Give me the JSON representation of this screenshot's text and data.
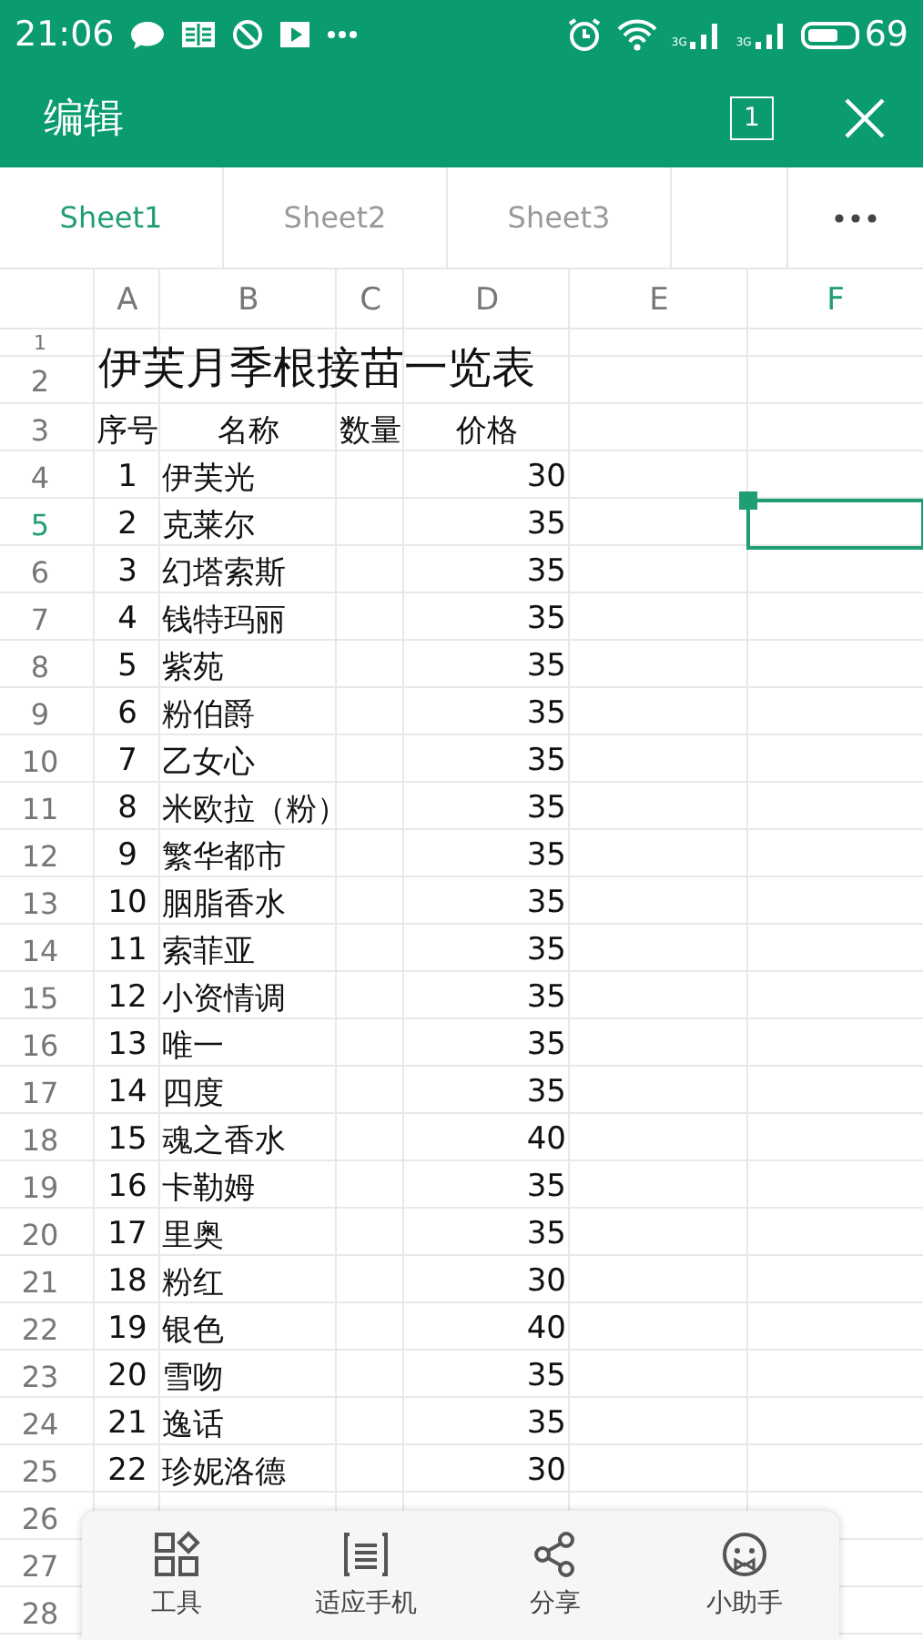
{
  "status_bar": {
    "time": "21:06",
    "network_labels": [
      "3G",
      "3G"
    ],
    "battery": "69"
  },
  "header": {
    "title": "编辑",
    "window_count": "1"
  },
  "tabs": [
    {
      "label": "Sheet1",
      "selected": true
    },
    {
      "label": "Sheet2",
      "selected": false
    },
    {
      "label": "Sheet3",
      "selected": false
    }
  ],
  "columns": [
    {
      "label": "A",
      "selected": false
    },
    {
      "label": "B",
      "selected": false
    },
    {
      "label": "C",
      "selected": false
    },
    {
      "label": "D",
      "selected": false
    },
    {
      "label": "E",
      "selected": false
    },
    {
      "label": "F",
      "selected": true
    }
  ],
  "row_headers": [
    {
      "label": "1",
      "selected": false
    },
    {
      "label": "2",
      "selected": false
    },
    {
      "label": "3",
      "selected": false
    },
    {
      "label": "4",
      "selected": false
    },
    {
      "label": "5",
      "selected": true
    },
    {
      "label": "6",
      "selected": false
    },
    {
      "label": "7",
      "selected": false
    },
    {
      "label": "8",
      "selected": false
    },
    {
      "label": "9",
      "selected": false
    },
    {
      "label": "10",
      "selected": false
    },
    {
      "label": "11",
      "selected": false
    },
    {
      "label": "12",
      "selected": false
    },
    {
      "label": "13",
      "selected": false
    },
    {
      "label": "14",
      "selected": false
    },
    {
      "label": "15",
      "selected": false
    },
    {
      "label": "16",
      "selected": false
    },
    {
      "label": "17",
      "selected": false
    },
    {
      "label": "18",
      "selected": false
    },
    {
      "label": "19",
      "selected": false
    },
    {
      "label": "20",
      "selected": false
    },
    {
      "label": "21",
      "selected": false
    },
    {
      "label": "22",
      "selected": false
    },
    {
      "label": "23",
      "selected": false
    },
    {
      "label": "24",
      "selected": false
    },
    {
      "label": "25",
      "selected": false
    },
    {
      "label": "26",
      "selected": false
    },
    {
      "label": "27",
      "selected": false
    },
    {
      "label": "28",
      "selected": false
    }
  ],
  "sheet_title": "伊芙月季根接苗一览表",
  "column_titles": [
    "序号",
    "名称",
    "数量",
    "价格"
  ],
  "records": [
    {
      "seq": "1",
      "name": "伊芙光",
      "price": "30"
    },
    {
      "seq": "2",
      "name": "克莱尔",
      "price": "35"
    },
    {
      "seq": "3",
      "name": "幻塔索斯",
      "price": "35"
    },
    {
      "seq": "4",
      "name": "钱特玛丽",
      "price": "35"
    },
    {
      "seq": "5",
      "name": "紫苑",
      "price": "35"
    },
    {
      "seq": "6",
      "name": "粉伯爵",
      "price": "35"
    },
    {
      "seq": "7",
      "name": "乙女心",
      "price": "35"
    },
    {
      "seq": "8",
      "name": "米欧拉（粉）",
      "price": "35"
    },
    {
      "seq": "9",
      "name": "繁华都市",
      "price": "35"
    },
    {
      "seq": "10",
      "name": "胭脂香水",
      "price": "35"
    },
    {
      "seq": "11",
      "name": "索菲亚",
      "price": "35"
    },
    {
      "seq": "12",
      "name": "小资情调",
      "price": "35"
    },
    {
      "seq": "13",
      "name": "唯一",
      "price": "35"
    },
    {
      "seq": "14",
      "name": "四度",
      "price": "35"
    },
    {
      "seq": "15",
      "name": "魂之香水",
      "price": "40"
    },
    {
      "seq": "16",
      "name": "卡勒姆",
      "price": "35"
    },
    {
      "seq": "17",
      "name": "里奥",
      "price": "35"
    },
    {
      "seq": "18",
      "name": "粉红",
      "price": "30"
    },
    {
      "seq": "19",
      "name": "银色",
      "price": "40"
    },
    {
      "seq": "20",
      "name": "雪吻",
      "price": "35"
    },
    {
      "seq": "21",
      "name": "逸话",
      "price": "35"
    },
    {
      "seq": "22",
      "name": "珍妮洛德",
      "price": "30"
    }
  ],
  "toolbar": [
    {
      "kind": "tools",
      "label": "工具"
    },
    {
      "kind": "fit",
      "label": "适应手机"
    },
    {
      "kind": "share",
      "label": "分享"
    },
    {
      "kind": "assistant",
      "label": "小助手"
    }
  ]
}
